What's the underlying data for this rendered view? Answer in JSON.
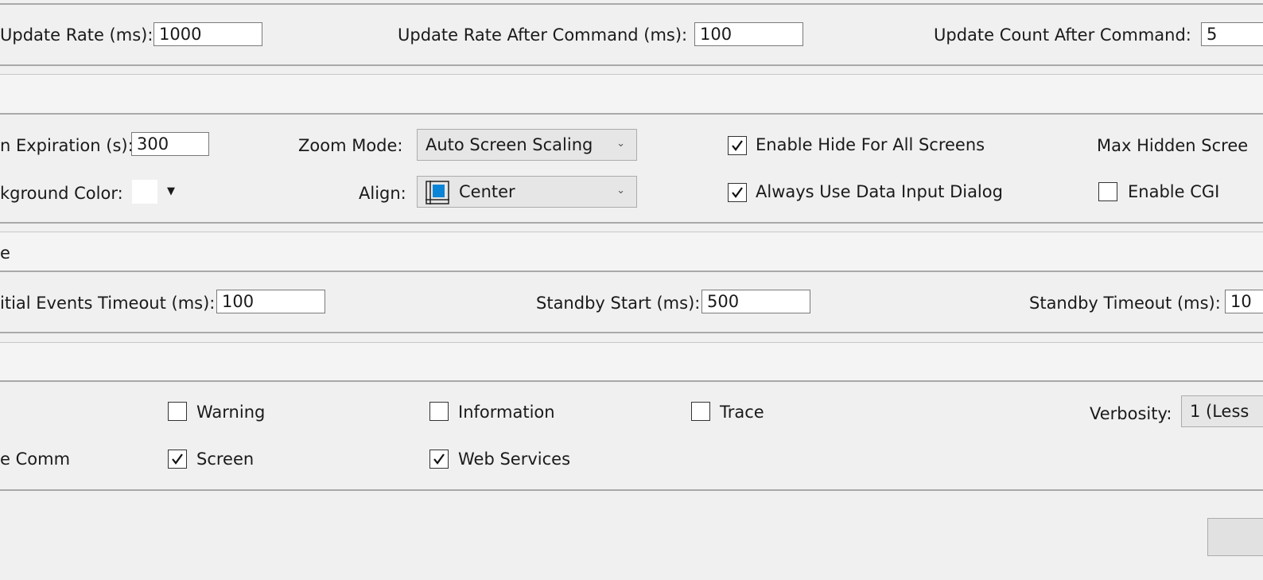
{
  "comm": {
    "update_rate_label": "Update Rate (ms):",
    "update_rate_value": "1000",
    "update_rate_after_label": "Update Rate After Command (ms):",
    "update_rate_after_value": "100",
    "update_count_label": "Update Count After Command:",
    "update_count_value": "5"
  },
  "screen": {
    "expiration_label": "n Expiration (s):",
    "expiration_value": "300",
    "zoom_mode_label": "Zoom Mode:",
    "zoom_mode_value": "Auto Screen Scaling",
    "enable_hide_label": "Enable Hide For All Screens",
    "enable_hide_checked": true,
    "max_hidden_label": "Max Hidden Scree",
    "background_color_label": "kground Color:",
    "background_color_value": "#ffffff",
    "align_label": "Align:",
    "align_value": "Center",
    "always_data_input_label": "Always Use Data Input Dialog",
    "always_data_input_checked": true,
    "enable_cgi_label": "Enable CGI",
    "enable_cgi_checked": false
  },
  "standby": {
    "section_title_fragment": "e",
    "initial_events_label": "itial Events Timeout (ms):",
    "initial_events_value": "100",
    "standby_start_label": "Standby Start (ms):",
    "standby_start_value": "500",
    "standby_timeout_label": "Standby Timeout (ms):",
    "standby_timeout_value": "10"
  },
  "logging": {
    "warning_label": "Warning",
    "warning_checked": false,
    "information_label": "Information",
    "information_checked": false,
    "trace_label": "Trace",
    "trace_checked": false,
    "verbosity_label": "Verbosity:",
    "verbosity_value": "1 (Less",
    "comm_label": "e Comm",
    "screen_label": "Screen",
    "screen_checked": true,
    "web_services_label": "Web Services",
    "web_services_checked": true
  },
  "colors": {
    "background": "#f0f0f0",
    "align_icon_fill": "#0a84d6"
  },
  "icons": [
    "dropdown-chevron",
    "dropdown-arrow",
    "checkmark",
    "align-center-icon"
  ]
}
